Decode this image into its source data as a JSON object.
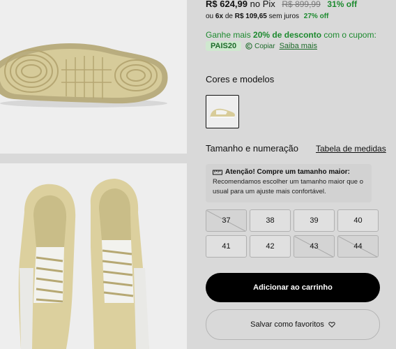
{
  "price": {
    "current": "R$ 624,99",
    "method": "no Pix",
    "old": "R$ 899,99",
    "off": "31% off"
  },
  "installments": {
    "prefix": "ou",
    "count": "6x",
    "middle": "de",
    "value": "R$ 109,65",
    "suffix": "sem juros",
    "off": "27% off"
  },
  "promo": {
    "text_before": "Ganhe mais",
    "highlight": "20% de desconto",
    "text_after": "com o cupom:",
    "coupon_code": "PAIS20",
    "copy_label": "Copiar",
    "learn_more": "Saiba mais"
  },
  "colors_section": {
    "title": "Cores e modelos"
  },
  "size_section": {
    "title": "Tamanho e numeração",
    "size_table_link": "Tabela de medidas"
  },
  "notice": {
    "title": "Atenção! Compre um tamanho maior:",
    "line1": "Recomendamos escolher um tamanho maior que o",
    "line2": "usual para um ajuste mais confortável."
  },
  "sizes": [
    {
      "label": "37",
      "available": false
    },
    {
      "label": "38",
      "available": true
    },
    {
      "label": "39",
      "available": true
    },
    {
      "label": "40",
      "available": true
    },
    {
      "label": "41",
      "available": true
    },
    {
      "label": "42",
      "available": true
    },
    {
      "label": "43",
      "available": false
    },
    {
      "label": "44",
      "available": false
    }
  ],
  "actions": {
    "add_to_cart": "Adicionar ao carrinho",
    "save_favorite": "Salvar como favoritos"
  },
  "icons": {
    "copy": "copy-icon",
    "ruler": "ruler-icon",
    "heart": "heart-icon"
  },
  "colors": {
    "accent_green": "#1d8a2f",
    "button_black": "#000000",
    "background": "#d9d9d9"
  }
}
